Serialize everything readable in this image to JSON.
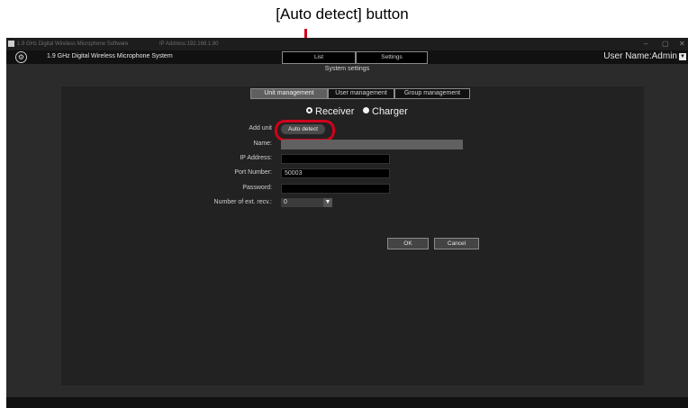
{
  "annotation": {
    "label": "[Auto detect] button"
  },
  "titlebar": {
    "app_name": "1.9 GHz Digital Wireless Microphone Software",
    "ip_address": "IP Address:192.168.1.80",
    "minimize": "–",
    "maximize": "▢",
    "close": "✕"
  },
  "header": {
    "system_name": "1.9 GHz Digital Wireless Microphone System",
    "tabs": [
      "List",
      "Settings"
    ],
    "user": "User Name:Admin"
  },
  "page": {
    "title": "System settings"
  },
  "segments": [
    "Unit management",
    "User management",
    "Group management"
  ],
  "unit_type": {
    "options": [
      "Receiver",
      "Charger"
    ],
    "selected": "Receiver"
  },
  "form": {
    "add_unit_label": "Add unit",
    "auto_detect_label": "Auto detect",
    "name_label": "Name:",
    "name_value": "",
    "ip_label": "IP Address:",
    "ip_value": "",
    "port_label": "Port Number:",
    "port_value": "50003",
    "password_label": "Password:",
    "password_value": "",
    "ext_label": "Number of ext. recv.:",
    "ext_value": "0"
  },
  "actions": {
    "ok": "OK",
    "cancel": "Cancel"
  },
  "colors": {
    "annotation_red": "#d0021b",
    "background": "#2b2b2b",
    "panel": "#222222"
  }
}
